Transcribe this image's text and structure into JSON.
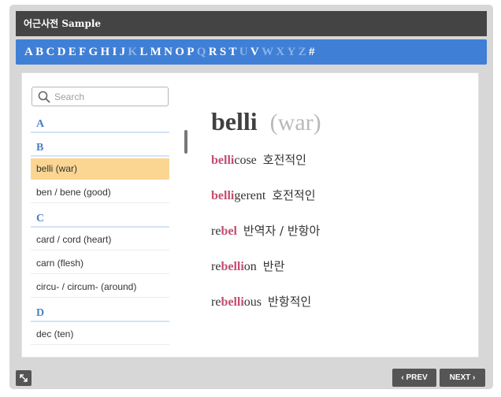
{
  "app": {
    "title": "어근사전 Sample"
  },
  "alphabet": [
    {
      "letter": "A",
      "enabled": true
    },
    {
      "letter": "B",
      "enabled": true
    },
    {
      "letter": "C",
      "enabled": true
    },
    {
      "letter": "D",
      "enabled": true
    },
    {
      "letter": "E",
      "enabled": true
    },
    {
      "letter": "F",
      "enabled": true
    },
    {
      "letter": "G",
      "enabled": true
    },
    {
      "letter": "H",
      "enabled": true
    },
    {
      "letter": "I",
      "enabled": true
    },
    {
      "letter": "J",
      "enabled": true
    },
    {
      "letter": "K",
      "enabled": false
    },
    {
      "letter": "L",
      "enabled": true
    },
    {
      "letter": "M",
      "enabled": true
    },
    {
      "letter": "N",
      "enabled": true
    },
    {
      "letter": "O",
      "enabled": true
    },
    {
      "letter": "P",
      "enabled": true
    },
    {
      "letter": "Q",
      "enabled": false
    },
    {
      "letter": "R",
      "enabled": true
    },
    {
      "letter": "S",
      "enabled": true
    },
    {
      "letter": "T",
      "enabled": true
    },
    {
      "letter": "U",
      "enabled": false
    },
    {
      "letter": "V",
      "enabled": true
    },
    {
      "letter": "W",
      "enabled": false
    },
    {
      "letter": "X",
      "enabled": false
    },
    {
      "letter": "Y",
      "enabled": false
    },
    {
      "letter": "Z",
      "enabled": false
    },
    {
      "letter": "#",
      "enabled": true
    }
  ],
  "search": {
    "placeholder": "Search",
    "value": ""
  },
  "root_list": [
    {
      "letter": "A",
      "items": []
    },
    {
      "letter": "B",
      "items": [
        {
          "label": "belli  (war)",
          "selected": true
        },
        {
          "label": "ben / bene  (good)",
          "selected": false
        }
      ]
    },
    {
      "letter": "C",
      "items": [
        {
          "label": "card / cord  (heart)",
          "selected": false
        },
        {
          "label": "carn  (flesh)",
          "selected": false
        },
        {
          "label": "circu- / circum-  (around)",
          "selected": false
        }
      ]
    },
    {
      "letter": "D",
      "items": [
        {
          "label": "dec  (ten)",
          "selected": false
        }
      ]
    }
  ],
  "detail": {
    "root": "belli",
    "meaning": "(war)",
    "words": [
      {
        "pre": "",
        "root": "belli",
        "post": "cose",
        "korean": "호전적인"
      },
      {
        "pre": "",
        "root": "belli",
        "post": "gerent",
        "korean": "호전적인"
      },
      {
        "pre": "re",
        "root": "bel",
        "post": "",
        "korean": "반역자 / 반항아"
      },
      {
        "pre": "re",
        "root": "belli",
        "post": "on",
        "korean": "반란"
      },
      {
        "pre": "re",
        "root": "belli",
        "post": "ous",
        "korean": "반항적인"
      }
    ]
  },
  "nav": {
    "prev_label": "PREV",
    "next_label": "NEXT"
  },
  "colors": {
    "accent": "#3f7fd6",
    "selected": "#fbd592",
    "root_highlight": "#c54d6f",
    "titlebar": "#444444"
  }
}
